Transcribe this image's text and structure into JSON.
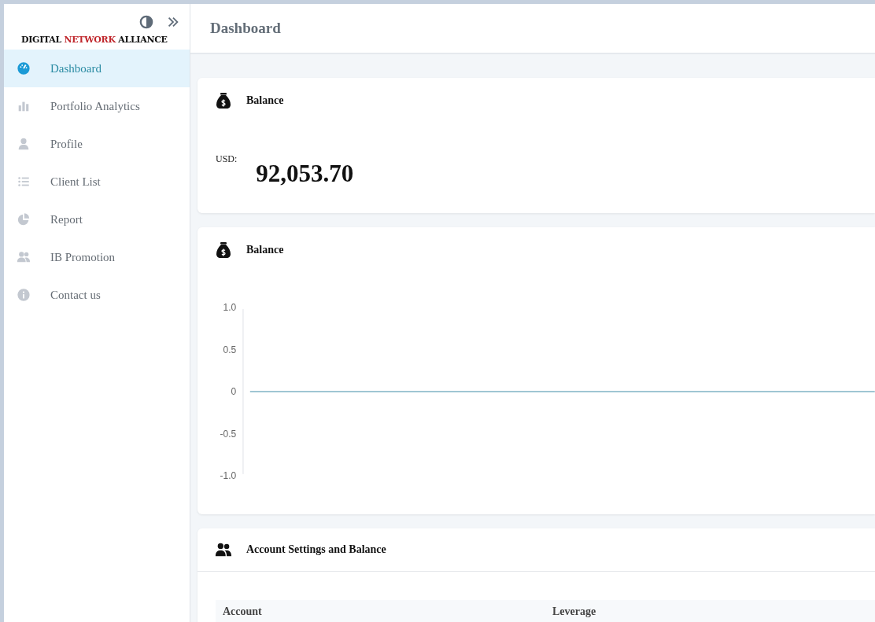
{
  "sidebar": {
    "logo": {
      "parts": [
        {
          "text": "DIGITAL ",
          "color": "#111111"
        },
        {
          "text": "NETWORK",
          "color": "#c0282d"
        },
        {
          "text": " ALLIANCE",
          "color": "#111111"
        }
      ]
    },
    "items": [
      {
        "label": "Dashboard",
        "selected": true
      },
      {
        "label": "Portfolio Analytics",
        "selected": false
      },
      {
        "label": "Profile",
        "selected": false
      },
      {
        "label": "Client List",
        "selected": false
      },
      {
        "label": "Report",
        "selected": false
      },
      {
        "label": "IB Promotion",
        "selected": false
      },
      {
        "label": "Contact us",
        "selected": false
      }
    ]
  },
  "header": {
    "title": "Dashboard"
  },
  "balance_card": {
    "title": "Balance",
    "currency": "USD:",
    "amount": "92,053.70"
  },
  "chart_card": {
    "title": "Balance",
    "chart_data": {
      "type": "line",
      "ylim": [
        -1,
        1
      ],
      "yticks": [
        {
          "value": 1,
          "label": "1.0"
        },
        {
          "value": 0.5,
          "label": "0.5"
        },
        {
          "value": 0,
          "label": "0"
        },
        {
          "value": -0.5,
          "label": "-0.5"
        },
        {
          "value": -1,
          "label": "-1.0"
        }
      ],
      "series": [
        {
          "color": "#7fb3c4",
          "values": [
            0,
            0,
            0,
            0,
            0,
            0,
            0,
            0,
            0,
            0,
            0,
            0,
            0,
            0,
            0,
            0,
            0,
            0,
            0,
            0,
            0,
            0,
            0,
            0,
            0,
            0,
            0,
            0,
            0,
            0
          ]
        }
      ]
    }
  },
  "account_card": {
    "title": "Account Settings and Balance",
    "columns": [
      "Account",
      "Leverage"
    ]
  }
}
